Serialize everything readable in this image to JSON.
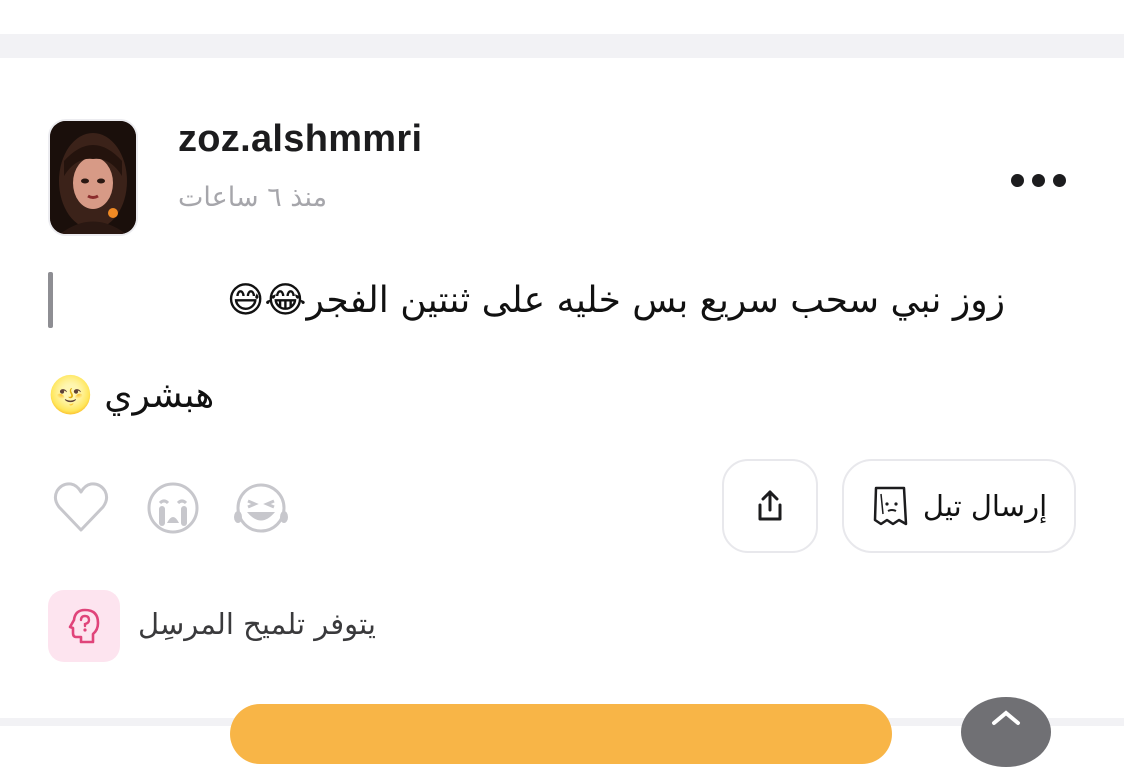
{
  "post": {
    "username": "zoz.alshmmri",
    "timestamp": "منذ ٦ ساعات",
    "message_line1": "زوز نبي سحب سريع بس خليه على ثنتين الفجر😂😅",
    "message_line2": "هبشري 🌝"
  },
  "actions": {
    "send_tell_label": "إرسال تيل"
  },
  "hint": {
    "text": "يتوفر تلميح المرسِل"
  },
  "colors": {
    "cta": "#f8b547",
    "hint_bg": "#fde4ef",
    "hint_icon": "#e0447a",
    "muted_text": "#a6a6ab"
  },
  "icons": [
    "more-icon",
    "heart-icon",
    "crying-emoji-icon",
    "laughing-emoji-icon",
    "share-icon",
    "tell-paper-icon",
    "hint-head-icon"
  ]
}
